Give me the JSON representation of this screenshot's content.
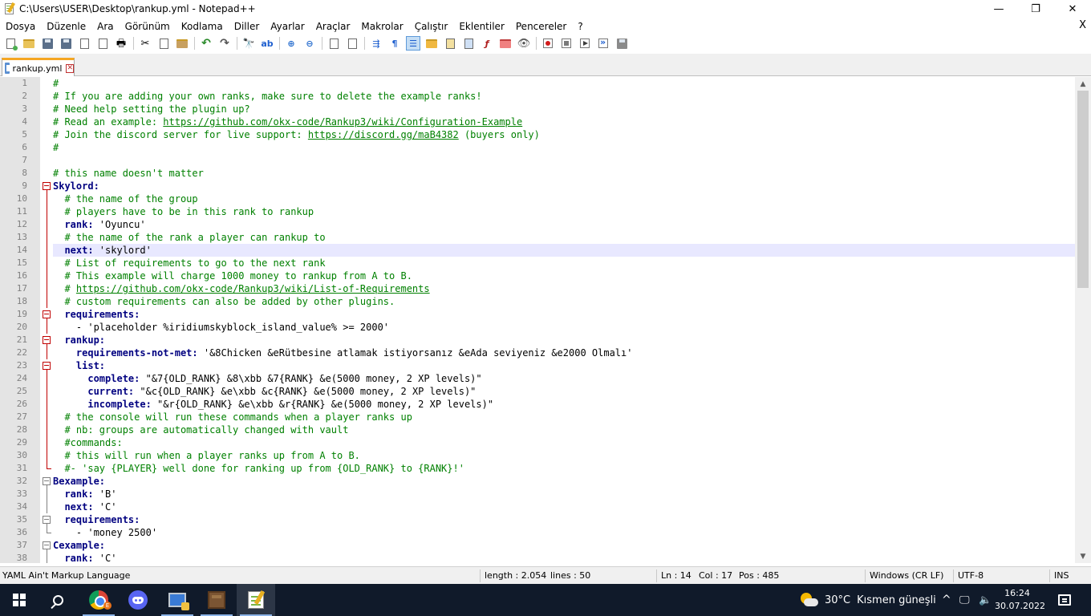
{
  "window": {
    "title": "C:\\Users\\USER\\Desktop\\rankup.yml - Notepad++",
    "controls": {
      "minimize": "—",
      "maximize": "❐",
      "close": "✕"
    }
  },
  "menu": {
    "items": [
      "Dosya",
      "Düzenle",
      "Ara",
      "Görünüm",
      "Kodlama",
      "Diller",
      "Ayarlar",
      "Araçlar",
      "Makrolar",
      "Çalıştır",
      "Eklentiler",
      "Pencereler",
      "?"
    ],
    "close_doc": "X"
  },
  "toolbar": {
    "icons": [
      "new-file-icon",
      "open-file-icon",
      "save-icon",
      "save-all-icon",
      "close-icon",
      "close-all-icon",
      "print-icon",
      "cut-icon",
      "copy-icon",
      "paste-icon",
      "undo-icon",
      "redo-icon",
      "find-icon",
      "replace-icon",
      "zoom-in-icon",
      "zoom-out-icon",
      "sync-vertical-icon",
      "sync-horizontal-icon",
      "word-wrap-icon",
      "show-all-chars-icon",
      "indent-guide-icon",
      "udl-icon",
      "doc-map-icon",
      "doc-list-icon",
      "function-list-icon",
      "folder-workspace-icon",
      "monitoring-icon",
      "record-macro-icon",
      "stop-macro-icon",
      "play-macro-icon",
      "run-macro-multiple-icon",
      "save-macro-icon"
    ]
  },
  "tab": {
    "label": "rankup.yml",
    "close": "✕"
  },
  "editor": {
    "current_line": 14,
    "lines": [
      {
        "n": "1",
        "parts": [
          {
            "t": "#",
            "c": "comment"
          }
        ]
      },
      {
        "n": "2",
        "parts": [
          {
            "t": "# If you are adding your own ranks, make sure to delete the example ranks!",
            "c": "comment"
          }
        ]
      },
      {
        "n": "3",
        "parts": [
          {
            "t": "# Need help setting the plugin up?",
            "c": "comment"
          }
        ]
      },
      {
        "n": "4",
        "parts": [
          {
            "t": "# Read an example: ",
            "c": "comment"
          },
          {
            "t": "https://github.com/okx-code/Rankup3/wiki/Configuration-Example",
            "c": "link"
          }
        ]
      },
      {
        "n": "5",
        "parts": [
          {
            "t": "# Join the discord server for live support: ",
            "c": "comment"
          },
          {
            "t": "https://discord.gg/maB4382",
            "c": "link"
          },
          {
            "t": " (buyers only)",
            "c": "comment"
          }
        ]
      },
      {
        "n": "6",
        "parts": [
          {
            "t": "#",
            "c": "comment"
          }
        ]
      },
      {
        "n": "7",
        "parts": []
      },
      {
        "n": "8",
        "parts": [
          {
            "t": "# this name doesn't matter",
            "c": "comment"
          }
        ]
      },
      {
        "n": "9",
        "parts": [
          {
            "t": "Skylord:",
            "c": "key"
          }
        ]
      },
      {
        "n": "10",
        "parts": [
          {
            "t": "  # the name of the group",
            "c": "comment"
          }
        ]
      },
      {
        "n": "11",
        "parts": [
          {
            "t": "  # players have to be in this rank to rankup",
            "c": "comment"
          }
        ]
      },
      {
        "n": "12",
        "parts": [
          {
            "t": "  rank:",
            "c": "key"
          },
          {
            "t": " 'Oyuncu'",
            "c": "val"
          }
        ]
      },
      {
        "n": "13",
        "parts": [
          {
            "t": "  # the name of the rank a player can rankup to",
            "c": "comment"
          }
        ]
      },
      {
        "n": "14",
        "parts": [
          {
            "t": "  next:",
            "c": "key"
          },
          {
            "t": " 'skylord'",
            "c": "val"
          }
        ]
      },
      {
        "n": "15",
        "parts": [
          {
            "t": "  # List of requirements to go to the next rank",
            "c": "comment"
          }
        ]
      },
      {
        "n": "16",
        "parts": [
          {
            "t": "  # This example will charge 1000 money to rankup from A to B.",
            "c": "comment"
          }
        ]
      },
      {
        "n": "17",
        "parts": [
          {
            "t": "  # ",
            "c": "comment"
          },
          {
            "t": "https://github.com/okx-code/Rankup3/wiki/List-of-Requirements",
            "c": "link"
          }
        ]
      },
      {
        "n": "18",
        "parts": [
          {
            "t": "  # custom requirements can also be added by other plugins.",
            "c": "comment"
          }
        ]
      },
      {
        "n": "19",
        "parts": [
          {
            "t": "  requirements:",
            "c": "key"
          }
        ]
      },
      {
        "n": "20",
        "parts": [
          {
            "t": "    - 'placeholder %iridiumskyblock_island_value% >= 2000'",
            "c": "val"
          }
        ]
      },
      {
        "n": "21",
        "parts": [
          {
            "t": "  rankup:",
            "c": "key"
          }
        ]
      },
      {
        "n": "22",
        "parts": [
          {
            "t": "    requirements-not-met:",
            "c": "key"
          },
          {
            "t": " '&8Chicken &eRütbesine atlamak istiyorsanız &eAda seviyeniz &e2000 Olmalı'",
            "c": "val"
          }
        ]
      },
      {
        "n": "23",
        "parts": [
          {
            "t": "    list:",
            "c": "key"
          }
        ]
      },
      {
        "n": "24",
        "parts": [
          {
            "t": "      complete:",
            "c": "key"
          },
          {
            "t": " \"&7{OLD_RANK} &8\\xbb &7{RANK} &e(5000 money, 2 XP levels)\"",
            "c": "val"
          }
        ]
      },
      {
        "n": "25",
        "parts": [
          {
            "t": "      current:",
            "c": "key"
          },
          {
            "t": " \"&c{OLD_RANK} &e\\xbb &c{RANK} &e(5000 money, 2 XP levels)\"",
            "c": "val"
          }
        ]
      },
      {
        "n": "26",
        "parts": [
          {
            "t": "      incomplete:",
            "c": "key"
          },
          {
            "t": " \"&r{OLD_RANK} &e\\xbb &r{RANK} &e(5000 money, 2 XP levels)\"",
            "c": "val"
          }
        ]
      },
      {
        "n": "27",
        "parts": [
          {
            "t": "  # the console will run these commands when a player ranks up",
            "c": "comment"
          }
        ]
      },
      {
        "n": "28",
        "parts": [
          {
            "t": "  # nb: groups are automatically changed with vault",
            "c": "comment"
          }
        ]
      },
      {
        "n": "29",
        "parts": [
          {
            "t": "  #commands:",
            "c": "comment"
          }
        ]
      },
      {
        "n": "30",
        "parts": [
          {
            "t": "  # this will run when a player ranks up from A to B.",
            "c": "comment"
          }
        ]
      },
      {
        "n": "31",
        "parts": [
          {
            "t": "  #- 'say {PLAYER} well done for ranking up from {OLD_RANK} to {RANK}!'",
            "c": "comment"
          }
        ]
      },
      {
        "n": "32",
        "parts": [
          {
            "t": "Bexample:",
            "c": "key"
          }
        ]
      },
      {
        "n": "33",
        "parts": [
          {
            "t": "  rank:",
            "c": "key"
          },
          {
            "t": " 'B'",
            "c": "val"
          }
        ]
      },
      {
        "n": "34",
        "parts": [
          {
            "t": "  next:",
            "c": "key"
          },
          {
            "t": " 'C'",
            "c": "val"
          }
        ]
      },
      {
        "n": "35",
        "parts": [
          {
            "t": "  requirements:",
            "c": "key"
          }
        ]
      },
      {
        "n": "36",
        "parts": [
          {
            "t": "    - 'money 2500'",
            "c": "val"
          }
        ]
      },
      {
        "n": "37",
        "parts": [
          {
            "t": "Cexample:",
            "c": "key"
          }
        ]
      },
      {
        "n": "38",
        "parts": [
          {
            "t": "  rank:",
            "c": "key"
          },
          {
            "t": " 'C'",
            "c": "val"
          }
        ]
      }
    ],
    "fold_markers": {
      "9": "open-red",
      "10": "line-red",
      "11": "line-red",
      "12": "line-red",
      "13": "line-red",
      "14": "line-red",
      "15": "line-red",
      "16": "line-red",
      "17": "line-red",
      "18": "line-red",
      "19": "open-red",
      "20": "line-red",
      "21": "open-red",
      "22": "line-red",
      "23": "open-red",
      "24": "line-red",
      "25": "line-red",
      "26": "line-red",
      "27": "line-red",
      "28": "line-red",
      "29": "line-red",
      "30": "line-red",
      "31": "end-red",
      "32": "open-gray",
      "33": "line-gray",
      "34": "line-gray",
      "35": "open-gray",
      "36": "end-gray",
      "37": "open-gray",
      "38": "line-gray"
    }
  },
  "statusbar": {
    "language": "YAML Ain't Markup Language",
    "length": "length : 2.054",
    "lines": "lines : 50",
    "ln": "Ln : 14",
    "col": "Col : 17",
    "pos": "Pos : 485",
    "eol": "Windows (CR LF)",
    "encoding": "UTF-8",
    "mode": "INS"
  },
  "taskbar": {
    "weather": {
      "temp": "30°C",
      "desc": "Kısmen güneşli"
    },
    "tray_chevron": "^",
    "time": "16:24",
    "date": "30.07.2022",
    "chrome_badge": "E"
  }
}
